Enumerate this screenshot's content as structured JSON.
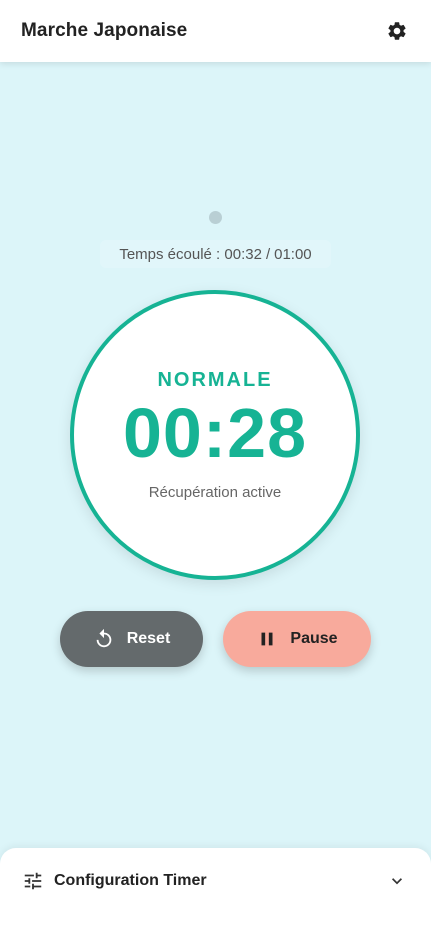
{
  "header": {
    "title": "Marche Japonaise",
    "settings_icon": "gear-icon"
  },
  "progress": {
    "elapsed_label": "Temps écoulé :",
    "elapsed": "00:32",
    "separator": "/",
    "total": "01:00"
  },
  "timer": {
    "mode": "NORMALE",
    "time": "00:28",
    "status": "Récupération active",
    "accent_color": "#16b394"
  },
  "controls": {
    "reset_label": "Reset",
    "reset_icon": "reset-icon",
    "pause_label": "Pause",
    "pause_icon": "pause-icon",
    "reset_color": "#646a6c",
    "pause_color": "#f8aa9c"
  },
  "config": {
    "title": "Configuration Timer",
    "icon": "tune-icon",
    "expand_icon": "chevron-down-icon"
  }
}
